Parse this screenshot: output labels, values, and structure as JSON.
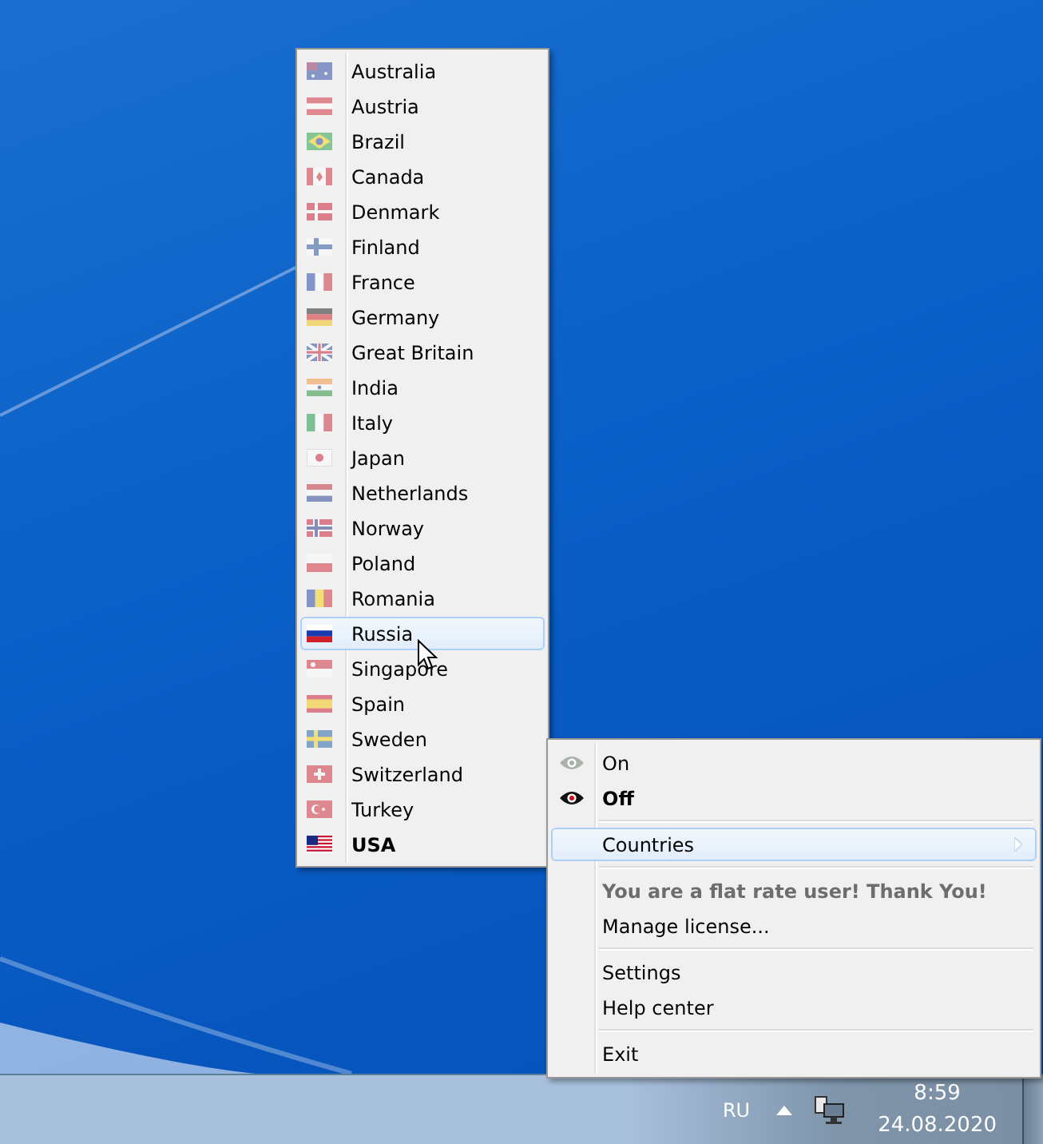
{
  "countries_menu": {
    "items": [
      {
        "label": "Australia",
        "selected": false,
        "active": false
      },
      {
        "label": "Austria",
        "selected": false,
        "active": false
      },
      {
        "label": "Brazil",
        "selected": false,
        "active": false
      },
      {
        "label": "Canada",
        "selected": false,
        "active": false
      },
      {
        "label": "Denmark",
        "selected": false,
        "active": false
      },
      {
        "label": "Finland",
        "selected": false,
        "active": false
      },
      {
        "label": "France",
        "selected": false,
        "active": false
      },
      {
        "label": "Germany",
        "selected": false,
        "active": false
      },
      {
        "label": "Great Britain",
        "selected": false,
        "active": false
      },
      {
        "label": "India",
        "selected": false,
        "active": false
      },
      {
        "label": "Italy",
        "selected": false,
        "active": false
      },
      {
        "label": "Japan",
        "selected": false,
        "active": false
      },
      {
        "label": "Netherlands",
        "selected": false,
        "active": false
      },
      {
        "label": "Norway",
        "selected": false,
        "active": false
      },
      {
        "label": "Poland",
        "selected": false,
        "active": false
      },
      {
        "label": "Romania",
        "selected": false,
        "active": false
      },
      {
        "label": "Russia",
        "selected": true,
        "active": false
      },
      {
        "label": "Singapore",
        "selected": false,
        "active": false
      },
      {
        "label": "Spain",
        "selected": false,
        "active": false
      },
      {
        "label": "Sweden",
        "selected": false,
        "active": false
      },
      {
        "label": "Switzerland",
        "selected": false,
        "active": false
      },
      {
        "label": "Turkey",
        "selected": false,
        "active": false
      },
      {
        "label": "USA",
        "selected": false,
        "active": true
      }
    ]
  },
  "tray_menu": {
    "items": [
      {
        "kind": "radio",
        "label": "On",
        "checked": false
      },
      {
        "kind": "radio",
        "label": "Off",
        "checked": true
      },
      {
        "kind": "separator"
      },
      {
        "kind": "submenu",
        "label": "Countries",
        "selected": true
      },
      {
        "kind": "separator"
      },
      {
        "kind": "notice",
        "label": "You are a flat rate user! Thank You!"
      },
      {
        "kind": "item",
        "label": "Manage license..."
      },
      {
        "kind": "separator"
      },
      {
        "kind": "item",
        "label": "Settings"
      },
      {
        "kind": "item",
        "label": "Help center"
      },
      {
        "kind": "separator"
      },
      {
        "kind": "item",
        "label": "Exit"
      }
    ]
  },
  "taskbar": {
    "language": "RU",
    "clock": {
      "time": "8:59",
      "date": "24.08.2020"
    }
  }
}
